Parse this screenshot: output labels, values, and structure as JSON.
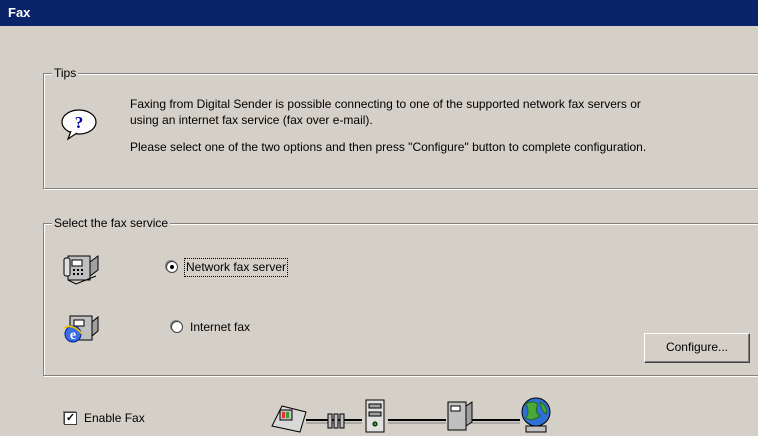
{
  "window": {
    "title": "Fax"
  },
  "tips": {
    "legend": "Tips",
    "line1": "Faxing from Digital Sender is possible connecting to one of the supported network fax servers or",
    "line2": "using an internet fax service (fax over e-mail).",
    "line3": "Please select one of the two options and then press \"Configure\" button to complete configuration."
  },
  "service": {
    "legend": "Select the fax service",
    "options": [
      {
        "label": "Network fax server",
        "selected": true
      },
      {
        "label": "Internet fax",
        "selected": false
      }
    ],
    "configure_label": "Configure..."
  },
  "enable_fax": {
    "label": "Enable Fax",
    "checked": true
  },
  "icons": [
    "help-question-icon",
    "fax-machine-icon",
    "internet-fax-icon",
    "fax-workflow-diagram"
  ]
}
